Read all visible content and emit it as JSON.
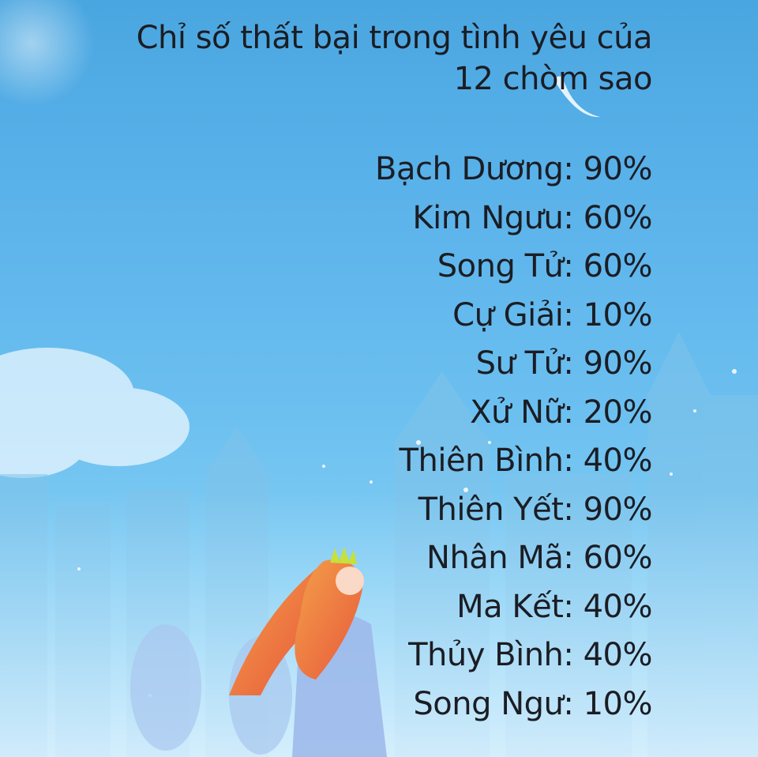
{
  "title": {
    "line1": "Chỉ số thất bại trong tình yêu của",
    "line2": "12 chòm sao"
  },
  "signs": [
    {
      "name": "Bạch Dương",
      "value": "90%"
    },
    {
      "name": "Kim Ngưu",
      "value": "60%"
    },
    {
      "name": "Song Tử",
      "value": "60%"
    },
    {
      "name": "Cự Giải",
      "value": "10%"
    },
    {
      "name": "Sư Tử",
      "value": "90%"
    },
    {
      "name": "Xử Nữ",
      "value": "20%"
    },
    {
      "name": "Thiên Bình",
      "value": "40%"
    },
    {
      "name": "Thiên Yết",
      "value": "90%"
    },
    {
      "name": "Nhân Mã",
      "value": "60%"
    },
    {
      "name": "Ma Kết",
      "value": "40%"
    },
    {
      "name": "Thủy Bình",
      "value": "40%"
    },
    {
      "name": "Song Ngư",
      "value": "10%"
    }
  ],
  "colors": {
    "sky_top": "#4aa6e0",
    "sky_bottom": "#9dd8f6",
    "text": "#1b1d24",
    "hair": "#f07a3c",
    "crown": "#c8e03a"
  }
}
